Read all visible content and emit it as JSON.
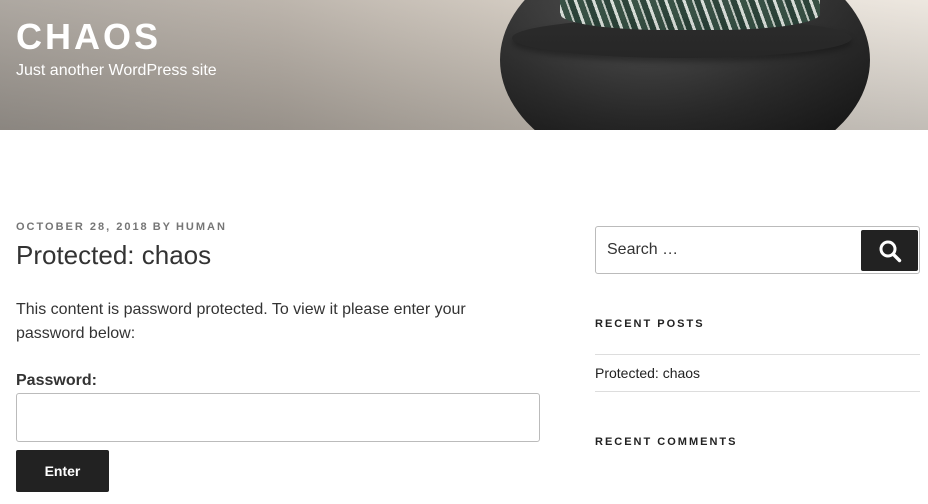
{
  "site": {
    "title": "CHAOS",
    "description": "Just another WordPress site"
  },
  "post": {
    "date": "OCTOBER 28, 2018",
    "by": "BY",
    "author": "HUMAN",
    "title": "Protected: chaos",
    "protected_message": "This content is password protected. To view it please enter your password below:",
    "password_label": "Password:",
    "password_value": "",
    "enter_label": "Enter"
  },
  "sidebar": {
    "search_placeholder": "Search …",
    "search_icon": "search-icon",
    "recent_posts_title": "RECENT POSTS",
    "recent_posts": [
      "Protected: chaos"
    ],
    "recent_comments_title": "RECENT COMMENTS"
  },
  "colors": {
    "button_bg": "#222222",
    "meta_text": "#767676",
    "body_text": "#333333"
  }
}
